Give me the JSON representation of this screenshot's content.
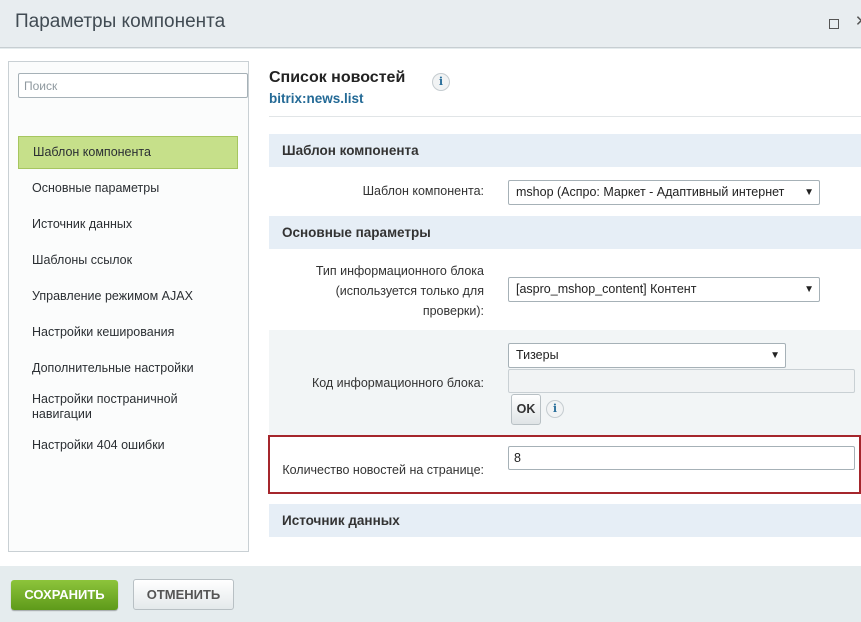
{
  "window": {
    "title": "Параметры компонента"
  },
  "sidebar": {
    "search_placeholder": "Поиск",
    "items": [
      {
        "label": "Шаблон компонента",
        "active": true
      },
      {
        "label": "Основные параметры"
      },
      {
        "label": "Источник данных"
      },
      {
        "label": "Шаблоны ссылок"
      },
      {
        "label": "Управление режимом AJAX"
      },
      {
        "label": "Настройки кеширования"
      },
      {
        "label": "Дополнительные настройки"
      },
      {
        "label": "Настройки постраничной навигации"
      },
      {
        "label": "Настройки 404 ошибки"
      }
    ]
  },
  "component": {
    "title": "Список новостей",
    "info_icon_glyph": "i",
    "id": "bitrix:news.list"
  },
  "sections": [
    {
      "title": "Шаблон компонента"
    },
    {
      "title": "Основные параметры"
    },
    {
      "title": "Источник данных"
    }
  ],
  "fields": {
    "template": {
      "label": "Шаблон компонента:",
      "value": "mshop (Аспро: Маркет - Адаптивный интернет"
    },
    "iblock_type": {
      "label": "Тип информационного блока (используется только для проверки):",
      "value": "[aspro_mshop_content] Контент"
    },
    "iblock_code": {
      "label": "Код информационного блока:",
      "value": "Тизеры",
      "extra_value": "",
      "ok_label": "OK"
    },
    "news_count": {
      "label": "Количество новостей на странице:",
      "value": "8"
    }
  },
  "footer": {
    "save_label": "СОХРАНИТЬ",
    "cancel_label": "ОТМЕНИТЬ"
  },
  "colors": {
    "accent_green": "#6aab23",
    "link_blue": "#246a96",
    "highlight_red": "#a5262c",
    "active_nav": "#c6e08a",
    "section_bg": "#e6eef6"
  }
}
